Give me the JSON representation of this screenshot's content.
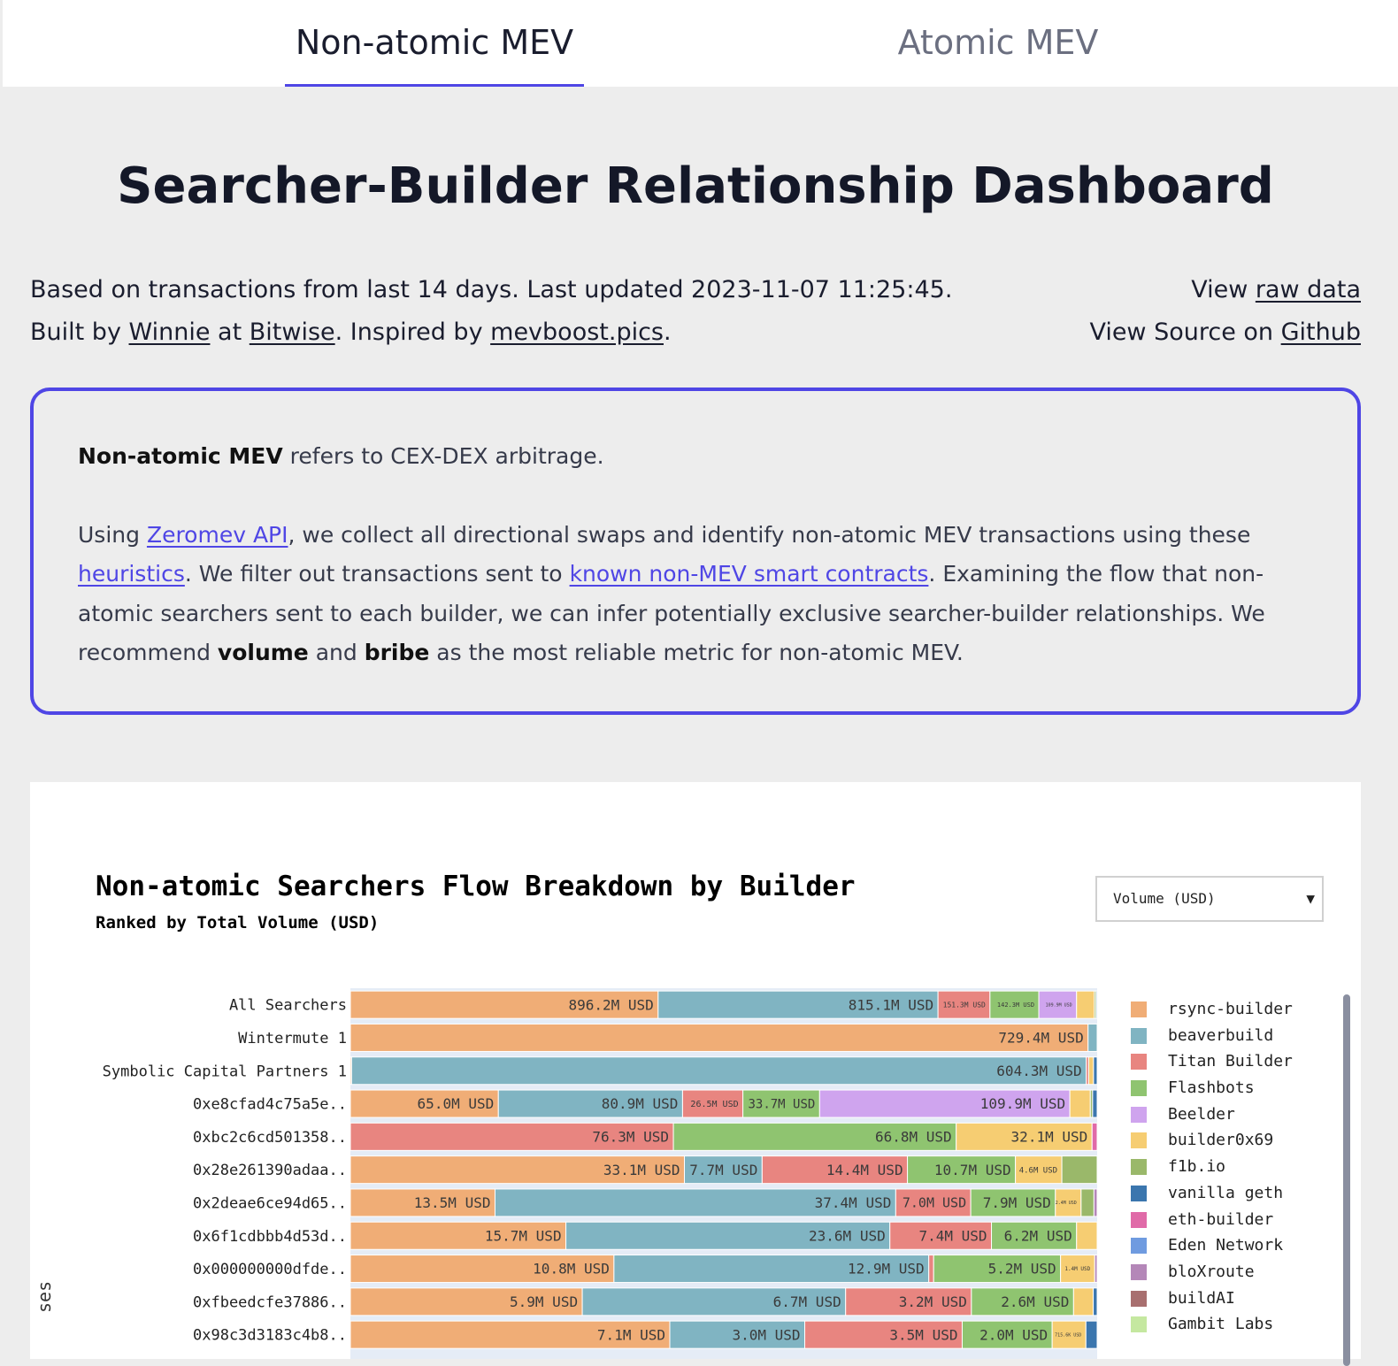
{
  "tabs": [
    {
      "label": "Non-atomic MEV",
      "active": true
    },
    {
      "label": "Atomic MEV",
      "active": false
    }
  ],
  "page_title": "Searcher-Builder Relationship Dashboard",
  "meta": {
    "line1": "Based on transactions from last 14 days. Last updated 2023-11-07 11:25:45.",
    "line2_prefix": "Built by ",
    "author_link": "Winnie",
    "at": " at ",
    "org_link": "Bitwise",
    "inspired": ". Inspired by ",
    "inspired_link": "mevboost.pics",
    "period": ".",
    "view_prefix": "View ",
    "raw_data_link": "raw data",
    "source_prefix": "View Source on ",
    "github_link": "Github"
  },
  "info": {
    "p1_bold": "Non-atomic MEV",
    "p1_rest": " refers to CEX-DEX arbitrage.",
    "p2_a": "Using ",
    "zeromev_link": "Zeromev API",
    "p2_b": ", we collect all directional swaps and identify non-atomic MEV transactions using these ",
    "heuristics_link": "heuristics",
    "p2_c": ". We filter out transactions sent to ",
    "known_link": "known non-MEV smart contracts",
    "p2_d": ". Examining the flow that non-atomic searchers sent to each builder, we can infer potentially exclusive searcher-builder relationships. We recommend ",
    "volume_bold": "volume",
    "p2_e": " and ",
    "bribe_bold": "bribe",
    "p2_f": " as the most reliable metric for non-atomic MEV."
  },
  "metric_select": {
    "value": "Volume (USD)"
  },
  "axis_label_partial": "ses",
  "chart_data": {
    "type": "bar",
    "orientation": "horizontal",
    "stacked": "normalized",
    "title": "Non-atomic Searchers Flow Breakdown by Builder",
    "subtitle": "Ranked by Total Volume (USD)",
    "unit": "USD",
    "categories": [
      "All Searchers",
      "Wintermute 1",
      "Symbolic Capital Partners 1",
      "0xe8cfad4c75a5e..",
      "0xbc2c6cd501358..",
      "0x28e261390adaa..",
      "0x2deae6ce94d65..",
      "0x6f1cdbbb4d53d..",
      "0x000000000dfde..",
      "0xfbeedcfe37886..",
      "0x98c3d3183c4b8.."
    ],
    "legend": [
      {
        "name": "rsync-builder",
        "color": "#f0ad76"
      },
      {
        "name": "beaverbuild",
        "color": "#80b4c2"
      },
      {
        "name": "Titan Builder",
        "color": "#e88580"
      },
      {
        "name": "Flashbots",
        "color": "#8fc470"
      },
      {
        "name": "Beelder",
        "color": "#cfa4ee"
      },
      {
        "name": "builder0x69",
        "color": "#f6cd72"
      },
      {
        "name": "f1b.io",
        "color": "#9ab86a"
      },
      {
        "name": "vanilla geth",
        "color": "#3b76ae"
      },
      {
        "name": "eth-builder",
        "color": "#e06aa8"
      },
      {
        "name": "Eden Network",
        "color": "#6f9be0"
      },
      {
        "name": "bloXroute",
        "color": "#b487b8"
      },
      {
        "name": "buildAI",
        "color": "#a86f6f"
      },
      {
        "name": "Gambit Labs",
        "color": "#c5e8a0"
      }
    ],
    "rows": [
      {
        "segments": [
          {
            "builder": "rsync-builder",
            "value": 896.2,
            "label": "896.2M USD"
          },
          {
            "builder": "beaverbuild",
            "value": 815.1,
            "label": "815.1M USD"
          },
          {
            "builder": "Titan Builder",
            "value": 151.3,
            "label": "151.3M USD"
          },
          {
            "builder": "Flashbots",
            "value": 142.3,
            "label": "142.3M USD"
          },
          {
            "builder": "Beelder",
            "value": 109.9,
            "label": "109.9M USD"
          },
          {
            "builder": "builder0x69",
            "value": 52,
            "label": ""
          },
          {
            "builder": "f1b.io",
            "value": 5,
            "label": ""
          },
          {
            "builder": "vanilla geth",
            "value": 3,
            "label": ""
          }
        ]
      },
      {
        "segments": [
          {
            "builder": "rsync-builder",
            "value": 729.4,
            "label": "729.4M USD"
          },
          {
            "builder": "beaverbuild",
            "value": 9,
            "label": ""
          }
        ]
      },
      {
        "segments": [
          {
            "builder": "rsync-builder",
            "value": 1,
            "label": ""
          },
          {
            "builder": "beaverbuild",
            "value": 604.3,
            "label": "604.3M USD"
          },
          {
            "builder": "Titan Builder",
            "value": 2,
            "label": ""
          },
          {
            "builder": "builder0x69",
            "value": 4,
            "label": ""
          },
          {
            "builder": "vanilla geth",
            "value": 3,
            "label": ""
          }
        ]
      },
      {
        "segments": [
          {
            "builder": "rsync-builder",
            "value": 65.0,
            "label": "65.0M USD"
          },
          {
            "builder": "beaverbuild",
            "value": 80.9,
            "label": "80.9M USD"
          },
          {
            "builder": "Titan Builder",
            "value": 26.5,
            "label": "26.5M USD"
          },
          {
            "builder": "Flashbots",
            "value": 33.7,
            "label": "33.7M USD"
          },
          {
            "builder": "Beelder",
            "value": 109.9,
            "label": "109.9M USD"
          },
          {
            "builder": "builder0x69",
            "value": 9,
            "label": ""
          },
          {
            "builder": "f1b.io",
            "value": 1,
            "label": ""
          },
          {
            "builder": "vanilla geth",
            "value": 2,
            "label": ""
          }
        ]
      },
      {
        "segments": [
          {
            "builder": "Titan Builder",
            "value": 76.3,
            "label": "76.3M USD"
          },
          {
            "builder": "Flashbots",
            "value": 66.8,
            "label": "66.8M USD"
          },
          {
            "builder": "builder0x69",
            "value": 32.1,
            "label": "32.1M USD"
          },
          {
            "builder": "eth-builder",
            "value": 1.2,
            "label": ""
          }
        ]
      },
      {
        "segments": [
          {
            "builder": "rsync-builder",
            "value": 33.1,
            "label": "33.1M USD"
          },
          {
            "builder": "beaverbuild",
            "value": 7.7,
            "label": "7.7M USD"
          },
          {
            "builder": "Titan Builder",
            "value": 14.4,
            "label": "14.4M USD"
          },
          {
            "builder": "Flashbots",
            "value": 10.7,
            "label": "10.7M USD"
          },
          {
            "builder": "builder0x69",
            "value": 4.6,
            "label": "4.6M USD"
          },
          {
            "builder": "f1b.io",
            "value": 3.5,
            "label": ""
          }
        ]
      },
      {
        "segments": [
          {
            "builder": "rsync-builder",
            "value": 13.5,
            "label": "13.5M USD"
          },
          {
            "builder": "beaverbuild",
            "value": 37.4,
            "label": "37.4M USD"
          },
          {
            "builder": "Titan Builder",
            "value": 7.0,
            "label": "7.0M USD"
          },
          {
            "builder": "Flashbots",
            "value": 7.9,
            "label": "7.9M USD"
          },
          {
            "builder": "builder0x69",
            "value": 2.4,
            "label": "2.4M USD"
          },
          {
            "builder": "f1b.io",
            "value": 1.2,
            "label": ""
          },
          {
            "builder": "bloXroute",
            "value": 0.3,
            "label": ""
          }
        ]
      },
      {
        "segments": [
          {
            "builder": "rsync-builder",
            "value": 15.7,
            "label": "15.7M USD"
          },
          {
            "builder": "beaverbuild",
            "value": 23.6,
            "label": "23.6M USD"
          },
          {
            "builder": "Titan Builder",
            "value": 7.4,
            "label": "7.4M USD"
          },
          {
            "builder": "Flashbots",
            "value": 6.2,
            "label": "6.2M USD"
          },
          {
            "builder": "builder0x69",
            "value": 1.5,
            "label": ""
          }
        ]
      },
      {
        "segments": [
          {
            "builder": "rsync-builder",
            "value": 10.8,
            "label": "10.8M USD"
          },
          {
            "builder": "beaverbuild",
            "value": 12.9,
            "label": "12.9M USD"
          },
          {
            "builder": "Titan Builder",
            "value": 0.2,
            "label": ""
          },
          {
            "builder": "Flashbots",
            "value": 5.2,
            "label": "5.2M USD"
          },
          {
            "builder": "builder0x69",
            "value": 1.4,
            "label": "1.4M USD"
          },
          {
            "builder": "bloXroute",
            "value": 0.1,
            "label": ""
          }
        ]
      },
      {
        "segments": [
          {
            "builder": "rsync-builder",
            "value": 5.9,
            "label": "5.9M USD"
          },
          {
            "builder": "beaverbuild",
            "value": 6.7,
            "label": "6.7M USD"
          },
          {
            "builder": "Titan Builder",
            "value": 3.2,
            "label": "3.2M USD"
          },
          {
            "builder": "Flashbots",
            "value": 2.6,
            "label": "2.6M USD"
          },
          {
            "builder": "builder0x69",
            "value": 0.5,
            "label": ""
          },
          {
            "builder": "vanilla geth",
            "value": 0.1,
            "label": ""
          }
        ]
      },
      {
        "segments": [
          {
            "builder": "rsync-builder",
            "value": 7.1,
            "label": "7.1M USD"
          },
          {
            "builder": "beaverbuild",
            "value": 3.0,
            "label": "3.0M USD"
          },
          {
            "builder": "Titan Builder",
            "value": 3.5,
            "label": "3.5M USD"
          },
          {
            "builder": "Flashbots",
            "value": 2.0,
            "label": "2.0M USD"
          },
          {
            "builder": "builder0x69",
            "value": 0.75,
            "label": "715.6K USD"
          },
          {
            "builder": "vanilla geth",
            "value": 0.25,
            "label": ""
          }
        ]
      }
    ]
  }
}
